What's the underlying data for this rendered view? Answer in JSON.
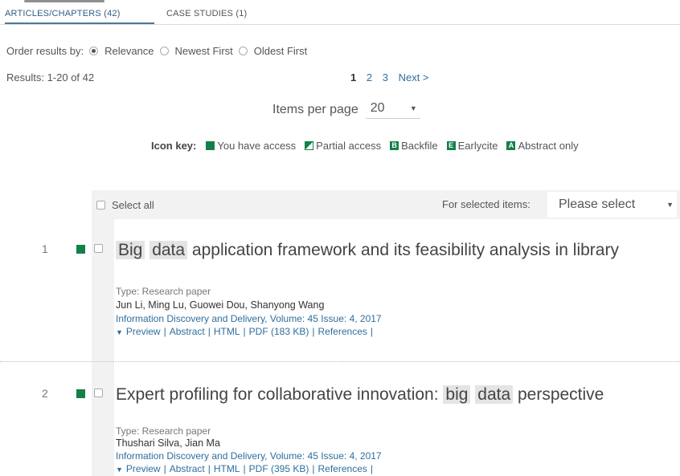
{
  "tabs": [
    {
      "label": "ARTICLES/CHAPTERS (42)",
      "active": true
    },
    {
      "label": "CASE STUDIES (1)",
      "active": false
    }
  ],
  "order": {
    "label": "Order results by:",
    "options": [
      {
        "label": "Relevance",
        "selected": true
      },
      {
        "label": "Newest First",
        "selected": false
      },
      {
        "label": "Oldest First",
        "selected": false
      }
    ]
  },
  "results_count": "Results: 1-20 of 42",
  "pager": {
    "pages": [
      "1",
      "2",
      "3"
    ],
    "current": "1",
    "next": "Next >"
  },
  "per_page": {
    "label": "Items per page",
    "value": "20"
  },
  "icon_key": {
    "title": "Icon key:",
    "items": [
      {
        "icon": "full-access-icon",
        "letter": "",
        "label": "You have access"
      },
      {
        "icon": "partial-access-icon",
        "letter": "",
        "label": "Partial access"
      },
      {
        "icon": "backfile-icon",
        "letter": "B",
        "label": "Backfile"
      },
      {
        "icon": "earlycite-icon",
        "letter": "E",
        "label": "Earlycite"
      },
      {
        "icon": "abstract-only-icon",
        "letter": "A",
        "label": "Abstract only"
      }
    ]
  },
  "select_bar": {
    "select_all": "Select all",
    "for_selected": "For selected items:",
    "bulk_value": "Please select"
  },
  "results": [
    {
      "number": "1",
      "title_parts": [
        "Big",
        " ",
        "data",
        " application framework and its feasibility analysis in library"
      ],
      "type": "Type: Research paper",
      "authors": "Jun Li, Ming Lu, Guowei Dou, Shanyong Wang",
      "journal": "Information Discovery and Delivery, Volume: 45 Issue: 4, 2017",
      "links": [
        "Preview",
        "Abstract",
        "HTML",
        "PDF (183 KB)",
        "References"
      ]
    },
    {
      "number": "2",
      "title_parts": [
        "Expert profiling for collaborative innovation: ",
        "big",
        " ",
        "data",
        " perspective"
      ],
      "type": "Type: Research paper",
      "authors": "Thushari Silva, Jian Ma",
      "journal": "Information Discovery and Delivery, Volume: 45 Issue: 4, 2017",
      "links": [
        "Preview",
        "Abstract",
        "HTML",
        "PDF (395 KB)",
        "References"
      ]
    }
  ],
  "colors": {
    "access_green": "#13804a",
    "link_blue": "#2e6e9e",
    "highlight_gray": "#e4e4e4"
  }
}
